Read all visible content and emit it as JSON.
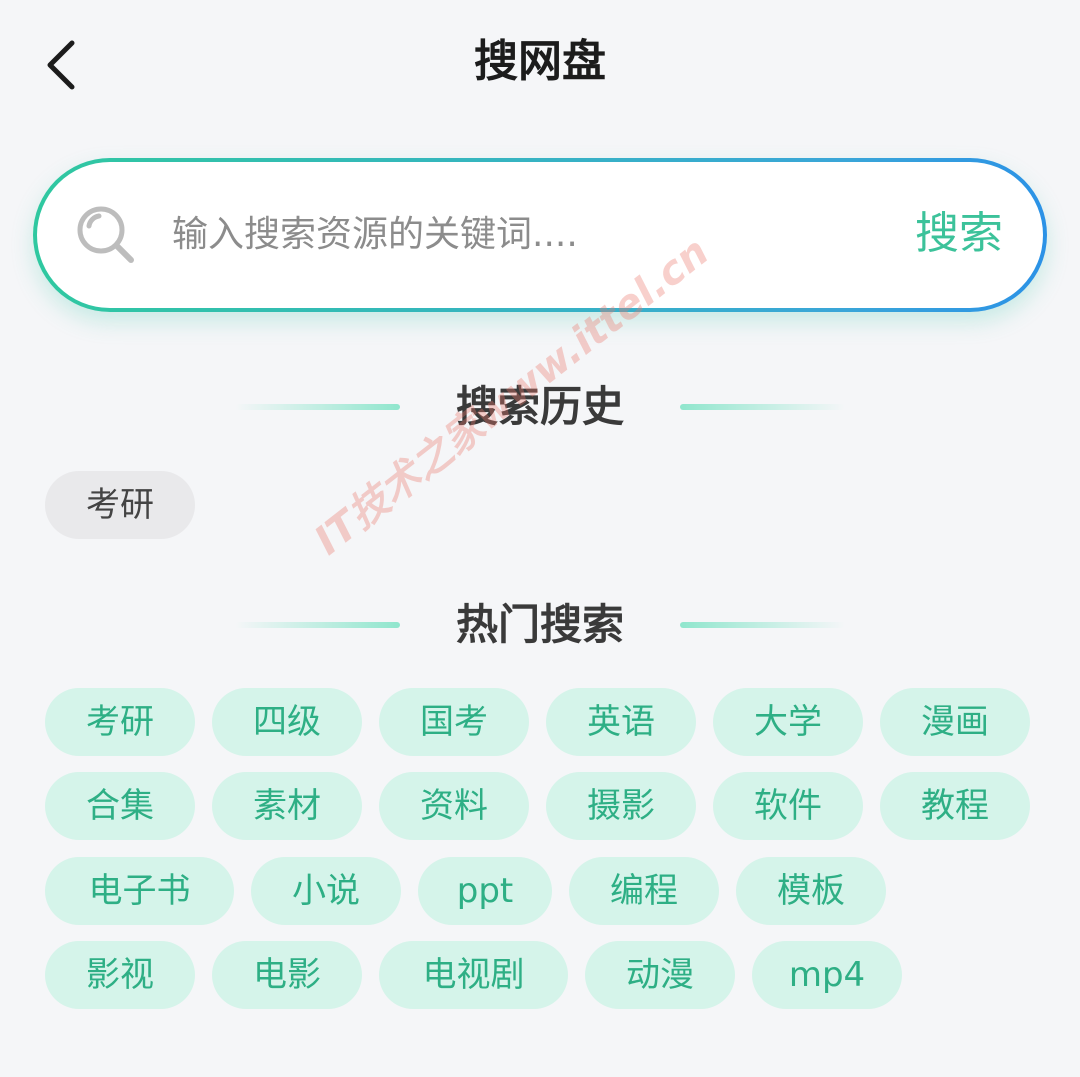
{
  "header": {
    "title": "搜网盘",
    "back_icon": "chevron-left-icon"
  },
  "search": {
    "placeholder": "输入搜索资源的关键词....",
    "value": "",
    "button_label": "搜索",
    "icon": "search-icon",
    "accent_color": "#3cc29a"
  },
  "history": {
    "title": "搜索历史",
    "items": [
      "考研"
    ]
  },
  "hot": {
    "title": "热门搜索",
    "items": [
      "考研",
      "四级",
      "国考",
      "英语",
      "大学",
      "漫画",
      "合集",
      "素材",
      "资料",
      "摄影",
      "软件",
      "教程",
      "电子书",
      "小说",
      "ppt",
      "编程",
      "模板",
      "影视",
      "电影",
      "电视剧",
      "动漫",
      "mp4"
    ]
  },
  "watermark": "IT技术之家www.ittel.cn"
}
